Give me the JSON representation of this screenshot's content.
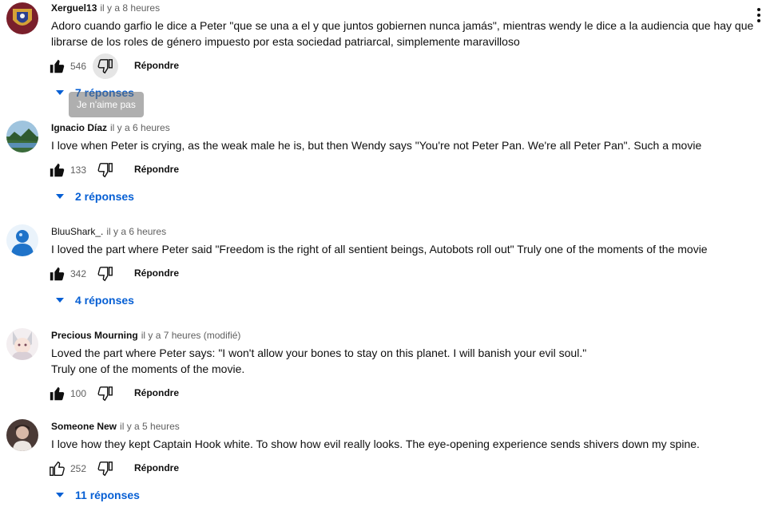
{
  "comments": [
    {
      "author": "Xerguel13",
      "time": "il y a 8 heures",
      "text": [
        "Adoro cuando  garfio le dice a Peter \"que se una a el y que juntos gobiernen nunca jamás\", mientras wendy le dice a la audiencia que hay que librarse de los roles de género impuesto por esta sociedad patriarcal, simplemente maravilloso"
      ],
      "likes": "546",
      "reply_label": "Répondre",
      "replies": "7 réponses",
      "liked": true
    },
    {
      "author": "Ignacio Díaz",
      "time": "il y a 6 heures",
      "text": [
        "I love when Peter is crying, as the weak male he is, but then Wendy says \"You're not Peter Pan. We're all Peter Pan\". Such a movie"
      ],
      "likes": "133",
      "reply_label": "Répondre",
      "replies": "2 réponses",
      "liked": true
    },
    {
      "author": "BluuShark_.",
      "time": "il y a 6 heures",
      "text": [
        "I loved the part where Peter said \"Freedom is the right of all sentient beings, Autobots roll out\" Truly one of the moments of the movie"
      ],
      "likes": "342",
      "reply_label": "Répondre",
      "replies": "4 réponses",
      "liked": true
    },
    {
      "author": "Precious Mourning",
      "time": "il y a 7 heures (modifié)",
      "text": [
        "Loved the part where Peter says: \"I won't allow your bones to stay on this planet. I will banish your evil soul.\"",
        "Truly one of the moments of the movie."
      ],
      "likes": "100",
      "reply_label": "Répondre",
      "replies": "",
      "liked": true
    },
    {
      "author": "Someone New",
      "time": "il y a 5 heures",
      "text": [
        "I love how they kept Captain Hook white. To show how evil really looks. The eye-opening experience sends shivers down my spine."
      ],
      "likes": "252",
      "reply_label": "Répondre",
      "replies": "11 réponses",
      "liked": false
    }
  ],
  "tooltip": "Je n'aime pas",
  "colors": {
    "link_blue": "#065fd4",
    "text": "#0f0f0f",
    "secondary": "#606060"
  },
  "icons": {
    "like": "thumbs-up-icon",
    "dislike": "thumbs-down-icon",
    "replies": "caret-down-icon",
    "menu": "more-vertical-icon"
  }
}
